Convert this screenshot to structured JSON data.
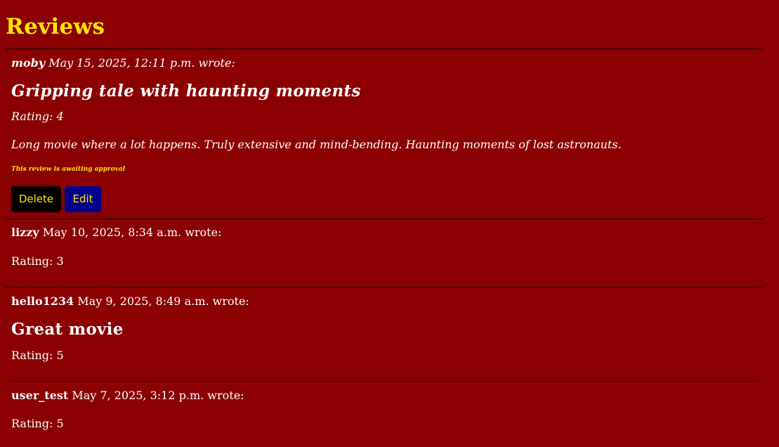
{
  "page": {
    "title": "Reviews"
  },
  "reviews": [
    {
      "author": "moby",
      "date": "May 15, 2025, 12:11 p.m.",
      "wrote": "wrote:",
      "title": "Gripping tale with haunting moments",
      "rating": "Rating: 4",
      "body": "Long movie where a lot happens. Truly extensive and mind-bending. Haunting moments of lost astronauts.",
      "approval_note": "This review is awaiting approval",
      "delete_label": "Delete",
      "edit_label": "Edit"
    },
    {
      "author": "lizzy",
      "date": "May 10, 2025, 8:34 a.m.",
      "wrote": "wrote:",
      "rating": "Rating: 3"
    },
    {
      "author": "hello1234",
      "date": "May 9, 2025, 8:49 a.m.",
      "wrote": "wrote:",
      "title": "Great movie",
      "rating": "Rating: 5"
    },
    {
      "author": "user_test",
      "date": "May 7, 2025, 3:12 p.m.",
      "wrote": "wrote:",
      "rating": "Rating: 5"
    }
  ],
  "colors": {
    "background": "#8b0000",
    "heading": "#ffe600",
    "text": "#ffffff",
    "delete_button": "#000000",
    "edit_button": "#00008b",
    "button_text": "#ffe600"
  }
}
